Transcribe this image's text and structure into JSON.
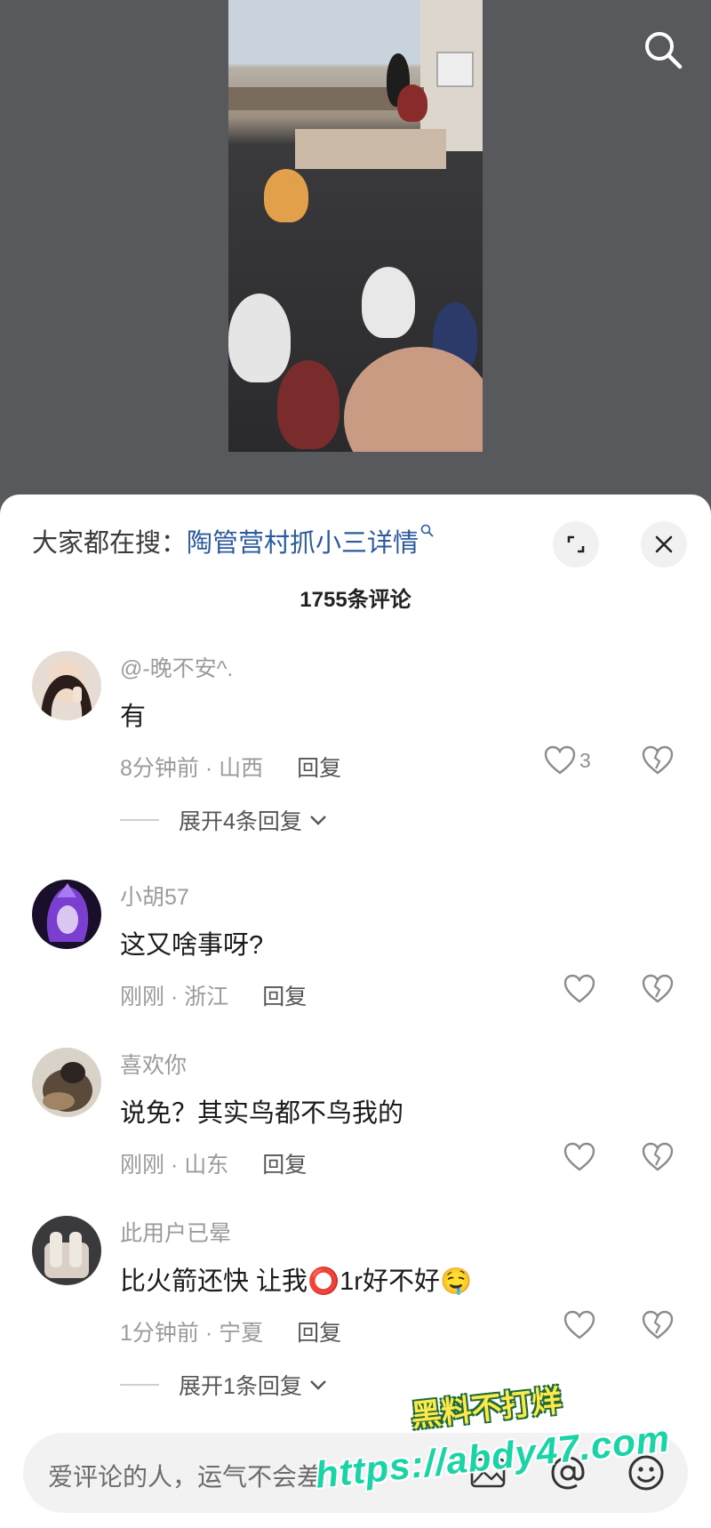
{
  "header": {
    "search_icon": "search-icon"
  },
  "trending": {
    "prefix": "大家都在搜：",
    "topic": "陶管营村抓小三详情",
    "topic_icon": "magnifier-small-icon"
  },
  "comments_header": {
    "count_label": "1755条评论"
  },
  "comments": [
    {
      "username": "@-晚不安^.",
      "text": "有",
      "time_location": "8分钟前 · 山西",
      "reply_label": "回复",
      "likes": "3",
      "expand_label": "展开4条回复"
    },
    {
      "username": "小胡57",
      "text": "这又啥事呀?",
      "time_location": "刚刚 · 浙江",
      "reply_label": "回复",
      "likes": ""
    },
    {
      "username": "喜欢你",
      "text": "说免？其实鸟都不鸟我的",
      "time_location": "刚刚 · 山东",
      "reply_label": "回复",
      "likes": ""
    },
    {
      "username": "此用户已晕",
      "text": "比火箭还快 让我⭕1r好不好🤤",
      "time_location": "1分钟前 · 宁夏",
      "reply_label": "回复",
      "likes": "",
      "expand_label": "展开1条回复"
    }
  ],
  "input": {
    "placeholder": "爱评论的人，运气不会差"
  },
  "watermark": {
    "line1": "黑料不打烊",
    "line2": "https://abdy47.com"
  },
  "colors": {
    "link": "#2b5a9e",
    "secondary_text": "#9b9b9b",
    "watermark_yellow": "#ffe84a",
    "watermark_teal": "#18d4a6"
  }
}
